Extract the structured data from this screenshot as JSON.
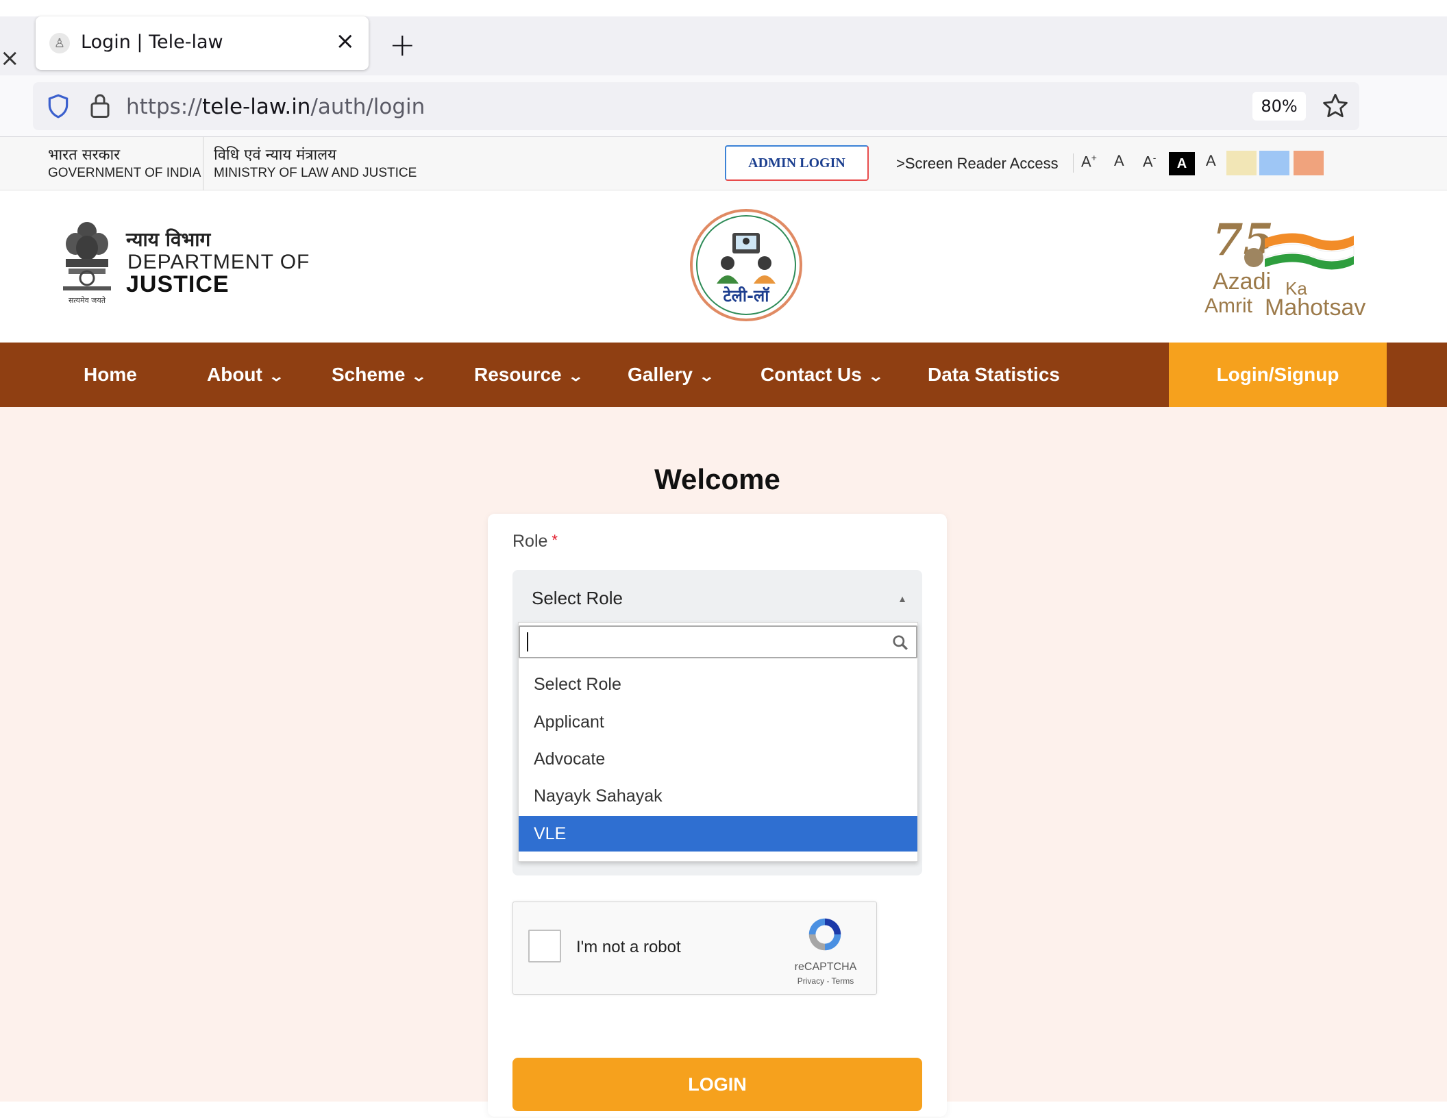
{
  "browser": {
    "tab_title": "Login | Tele-law",
    "url_scheme": "https://",
    "url_host": "tele-law.in",
    "url_path": "/auth/login",
    "zoom": "80%",
    "new_tab": "+",
    "close_glyph": "×"
  },
  "govbar": {
    "gov_hindi": "भारत सरकार",
    "gov_english": "GOVERNMENT OF INDIA",
    "ministry_hindi": "विधि एवं न्याय मंत्रालय",
    "ministry_english": "MINISTRY OF LAW AND JUSTICE",
    "admin_login": "ADMIN LOGIN",
    "screen_reader": ">Screen Reader Access",
    "font_increase": "A+",
    "font_normal": "A",
    "font_decrease": "A-",
    "contrast_dark": "A",
    "contrast_normal": "A",
    "theme_colors": [
      "#f2e6b6",
      "#9ec6f5",
      "#f0a37d"
    ]
  },
  "header": {
    "dept_hindi": "न्याय विभाग",
    "dept_line1": "DEPARTMENT OF",
    "dept_line2": "JUSTICE",
    "emblem_motto": "सत्यमेव जयते",
    "telelaw_text": "टेली-लॉ",
    "akam_line1": "Azadi",
    "akam_ka": "Ka",
    "akam_line2": "Amrit",
    "akam_mahotsav": "Mahotsav"
  },
  "nav": {
    "items": [
      {
        "label": "Home",
        "dropdown": false
      },
      {
        "label": "About",
        "dropdown": true
      },
      {
        "label": "Scheme",
        "dropdown": true
      },
      {
        "label": "Resource",
        "dropdown": true
      },
      {
        "label": "Gallery",
        "dropdown": true
      },
      {
        "label": "Contact Us",
        "dropdown": true
      },
      {
        "label": "Data Statistics",
        "dropdown": false
      }
    ],
    "login_signup": "Login/Signup",
    "colors": {
      "bar": "#8f3f12",
      "accent": "#f6a11d"
    }
  },
  "login": {
    "welcome": "Welcome",
    "role_label": "Role",
    "required_mark": "*",
    "selected_role": "Select Role",
    "search_value": "",
    "options": [
      "Select Role",
      "Applicant",
      "Advocate",
      "Nayayk Sahayak",
      "VLE"
    ],
    "highlighted_option": "VLE",
    "recaptcha_label": "I'm not a robot",
    "recaptcha_brand": "reCAPTCHA",
    "recaptcha_terms": "Privacy - Terms",
    "recaptcha_checked": false,
    "login_button": "LOGIN"
  }
}
